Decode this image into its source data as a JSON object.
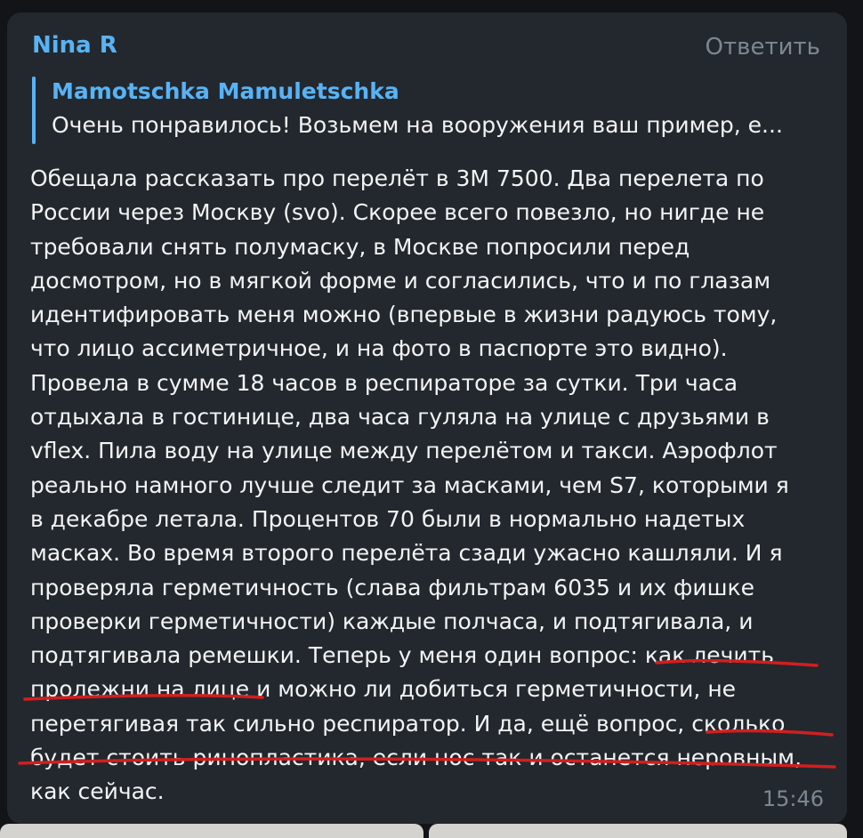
{
  "message": {
    "sender": "Nina R",
    "reply_label": "Ответить",
    "quote": {
      "author": "Mamotschka Mamuletschka",
      "text": "Очень понравилось! Возьмем на вооружения ваш пример, е..."
    },
    "lines": [
      "Обещала рассказать про перелёт в 3М 7500. Два перелета по",
      "России через Москву (svo). Скорее всего повезло, но нигде не",
      "требовали снять полумаску, в Москве попросили перед",
      "досмотром, но в мягкой форме и согласились, что и по глазам",
      "идентифировать меня можно (впервые в жизни радуюсь тому,",
      "что лицо ассиметричное, и на фото в паспорте это видно).",
      "Провела в сумме 18 часов в респираторе за сутки. Три часа",
      "отдыхала в гостинице, два часа гуляла на улице с друзьями в",
      "vflex. Пила воду на улице между перелётом и такси. Аэрофлот",
      "реально намного лучше следит за масками, чем S7, которыми я",
      "в декабре летала. Процентов 70 были в нормально надетых",
      "масках. Во время второго перелёта сзади ужасно кашляли. И я",
      "проверяла герметичность (слава фильтрам 6035 и их фишке",
      "проверки герметичности) каждые полчаса, и подтягивала, и",
      "подтягивала ремешки. Теперь у меня один вопрос: как лечить",
      "пролежни на лице и можно ли добиться герметичности, не",
      "перетягивая так сильно респиратор. И да, ещё вопрос, сколько",
      "будет стоить ринопластика, если нос так и останется неровным,",
      "как сейчас."
    ],
    "time": "15:46"
  },
  "colors": {
    "accent": "#58b3f5",
    "bubble": "#23282e",
    "underline": "#d11f1f"
  }
}
